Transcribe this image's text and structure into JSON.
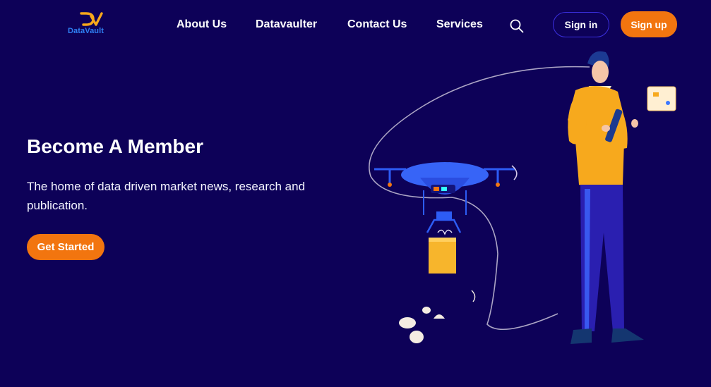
{
  "brand": {
    "name": "DataVault",
    "mark": "DV",
    "accent": "#f2750f",
    "text_color": "#2f7ff2"
  },
  "nav": {
    "items": [
      {
        "label": "About Us"
      },
      {
        "label": "Datavaulter"
      },
      {
        "label": "Contact Us"
      },
      {
        "label": "Services"
      }
    ],
    "search_icon": "search-icon",
    "signin_label": "Sign in",
    "signup_label": "Sign up"
  },
  "hero": {
    "title": "Become A Member",
    "subtitle": "The home of data driven market news, research and publication.",
    "cta_label": "Get Started"
  },
  "colors": {
    "background": "#0d0158",
    "primary_button": "#f2750f",
    "outline_button": "#3b2fe0"
  }
}
